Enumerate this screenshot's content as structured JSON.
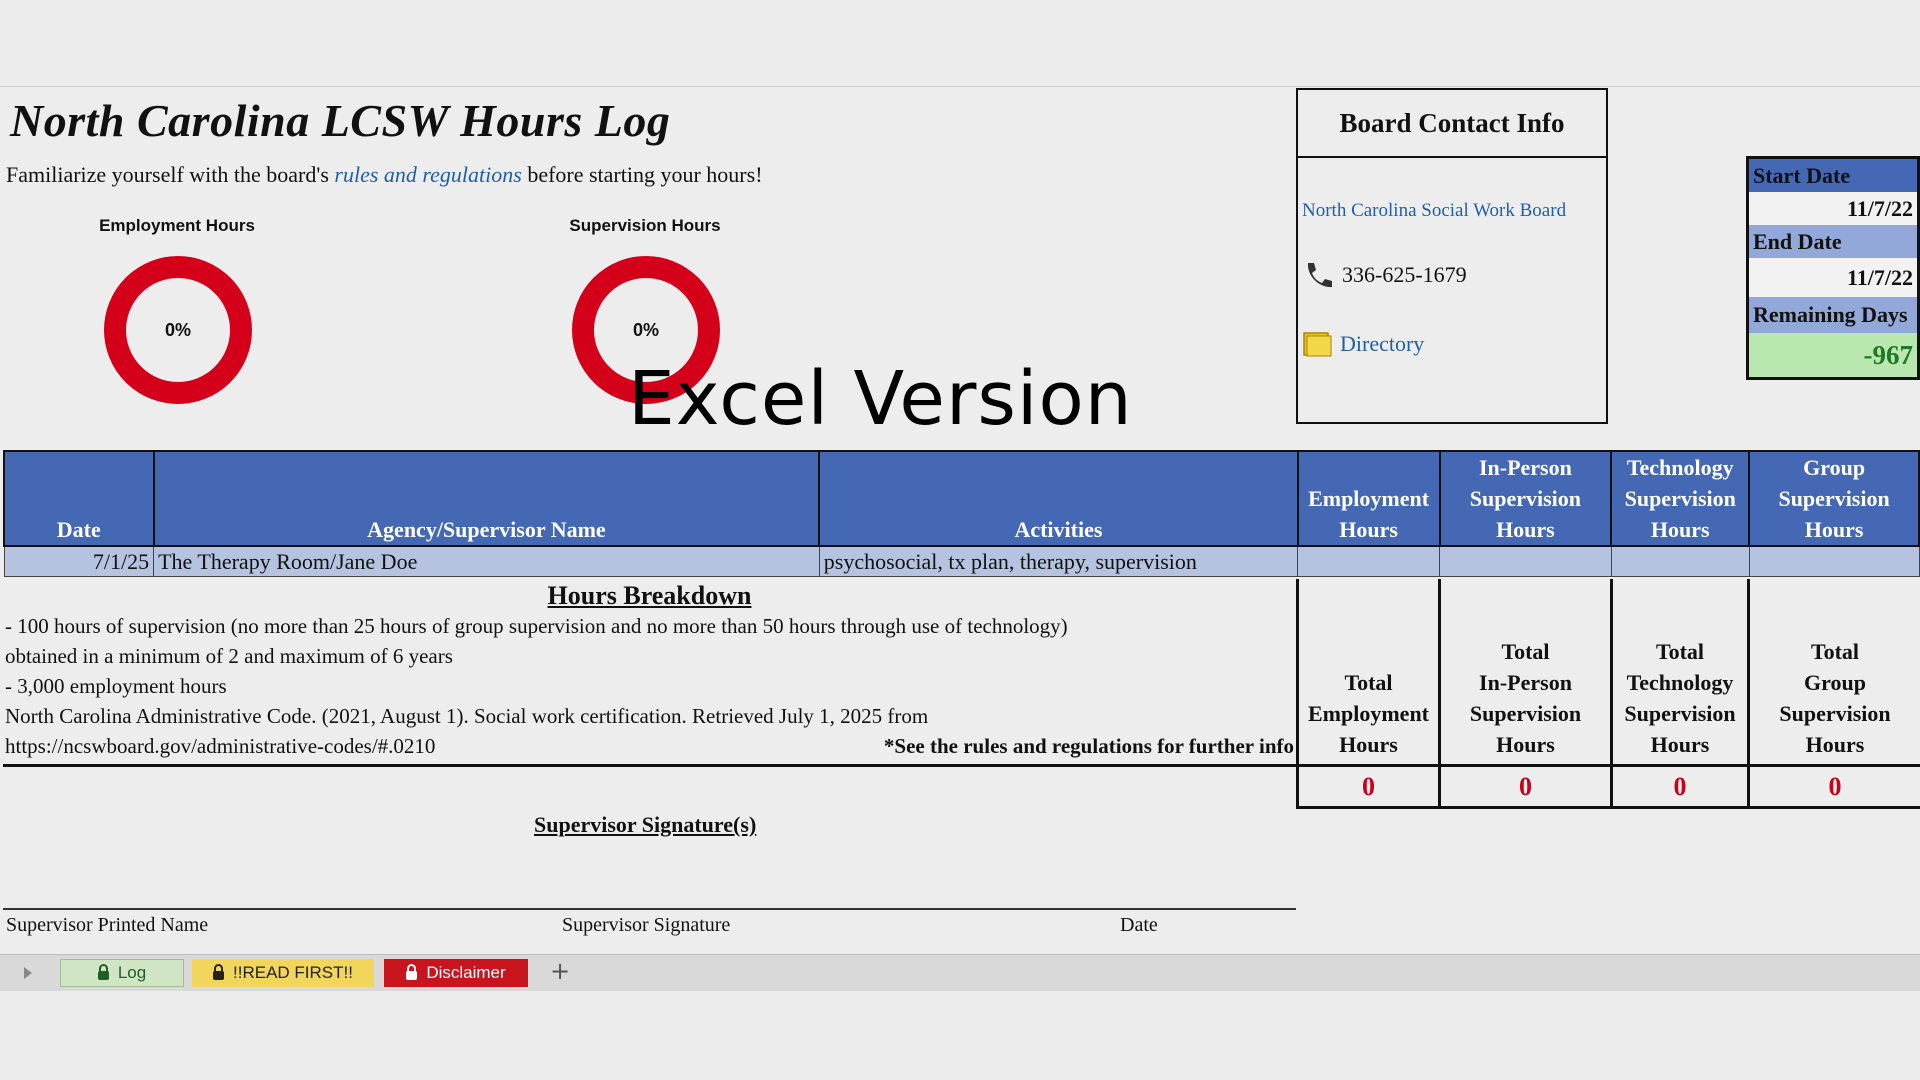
{
  "sheet": {
    "title": "North Carolina LCSW Hours Log",
    "intro_before": "Familiarize yourself with the board's ",
    "intro_link": "rules and regulations",
    "intro_after": " before starting your hours!"
  },
  "gauges": [
    {
      "label": "Employment Hours",
      "value": "0%"
    },
    {
      "label": "Supervision Hours",
      "value": "0%"
    }
  ],
  "watermark": "Excel Version",
  "board": {
    "title": "Board Contact Info",
    "link": "North Carolina Social Work Board",
    "phone_icon": "phone-icon",
    "phone": "336-625-1679",
    "directory_icon": "folder-icon",
    "directory": "Directory"
  },
  "dates": {
    "start_label": "Start Date",
    "start_value": "11/7/22",
    "end_label": "End Date",
    "end_value": "11/7/22",
    "remaining_label": "Remaining Days",
    "remaining_value": "-967"
  },
  "log_table": {
    "headers": {
      "date": "Date",
      "agency": "Agency/Supervisor Name",
      "activities": "Activities",
      "employment": [
        "Employment",
        "Hours"
      ],
      "in_person": [
        "In-Person",
        "Supervision",
        "Hours"
      ],
      "technology": [
        "Technology",
        "Supervision",
        "Hours"
      ],
      "group": [
        "Group",
        "Supervision",
        "Hours"
      ]
    },
    "rows": [
      {
        "date": "7/1/25",
        "agency": "The Therapy Room/Jane Doe",
        "activities": "psychosocial, tx plan, therapy, supervision"
      }
    ]
  },
  "breakdown": {
    "title": "Hours Breakdown",
    "line1": "- 100 hours of supervision (no more than 25 hours of group supervision and no more than 50 hours through use of technology)",
    "line2": "obtained in a minimum of 2 and maximum of 6 years",
    "line3": "- 3,000 employment hours",
    "line4": "North Carolina Administrative Code. (2021, August 1). Social work certification. Retrieved July 1, 2025 from",
    "line5_url": "https://ncswboard.gov/administrative-codes/#.0210",
    "line5_note": "*See the rules and regulations for further info"
  },
  "totals": [
    {
      "label": [
        "Total",
        "Employment",
        "Hours"
      ],
      "value": "0"
    },
    {
      "label": [
        "Total",
        "In-Person",
        "Supervision",
        "Hours"
      ],
      "value": "0"
    },
    {
      "label": [
        "Total",
        "Technology",
        "Supervision",
        "Hours"
      ],
      "value": "0"
    },
    {
      "label": [
        "Total",
        "Group",
        "Supervision",
        "Hours"
      ],
      "value": "0"
    }
  ],
  "signature": {
    "title": "Supervisor Signature(s)",
    "printed_name": "Supervisor Printed Name",
    "signature": "Supervisor Signature",
    "date": "Date"
  },
  "tabs": [
    {
      "label": "Log",
      "color": "#cfe5c4",
      "text_color": "#1f5e24"
    },
    {
      "label": "!!READ FIRST!!",
      "color": "#f2d65c",
      "text_color": "#222222"
    },
    {
      "label": "Disclaimer",
      "color": "#c8141c",
      "text_color": "#ffffff"
    }
  ],
  "add_sheet_label": "+"
}
